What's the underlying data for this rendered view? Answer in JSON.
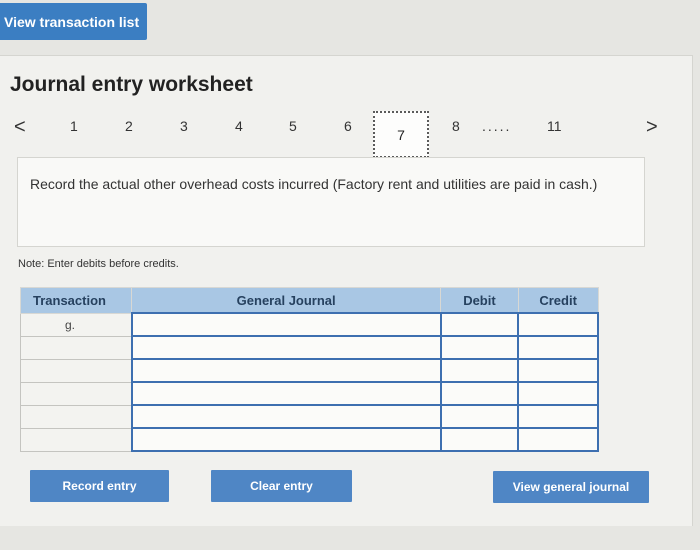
{
  "top_button": "View transaction list",
  "title": "Journal entry worksheet",
  "pager": {
    "prev_icon": "<",
    "next_icon": ">",
    "pages": [
      "1",
      "2",
      "3",
      "4",
      "5",
      "6",
      "7",
      "8"
    ],
    "ellipsis": ".....",
    "last": "11",
    "current": "7"
  },
  "instruction": "Record the actual other overhead costs incurred (Factory rent and utilities are paid in cash.)",
  "note": "Note: Enter debits before credits.",
  "table": {
    "headers": [
      "Transaction",
      "General Journal",
      "Debit",
      "Credit"
    ],
    "first_transaction": "g."
  },
  "buttons": {
    "record": "Record entry",
    "clear": "Clear entry",
    "view_journal": "View general journal"
  }
}
